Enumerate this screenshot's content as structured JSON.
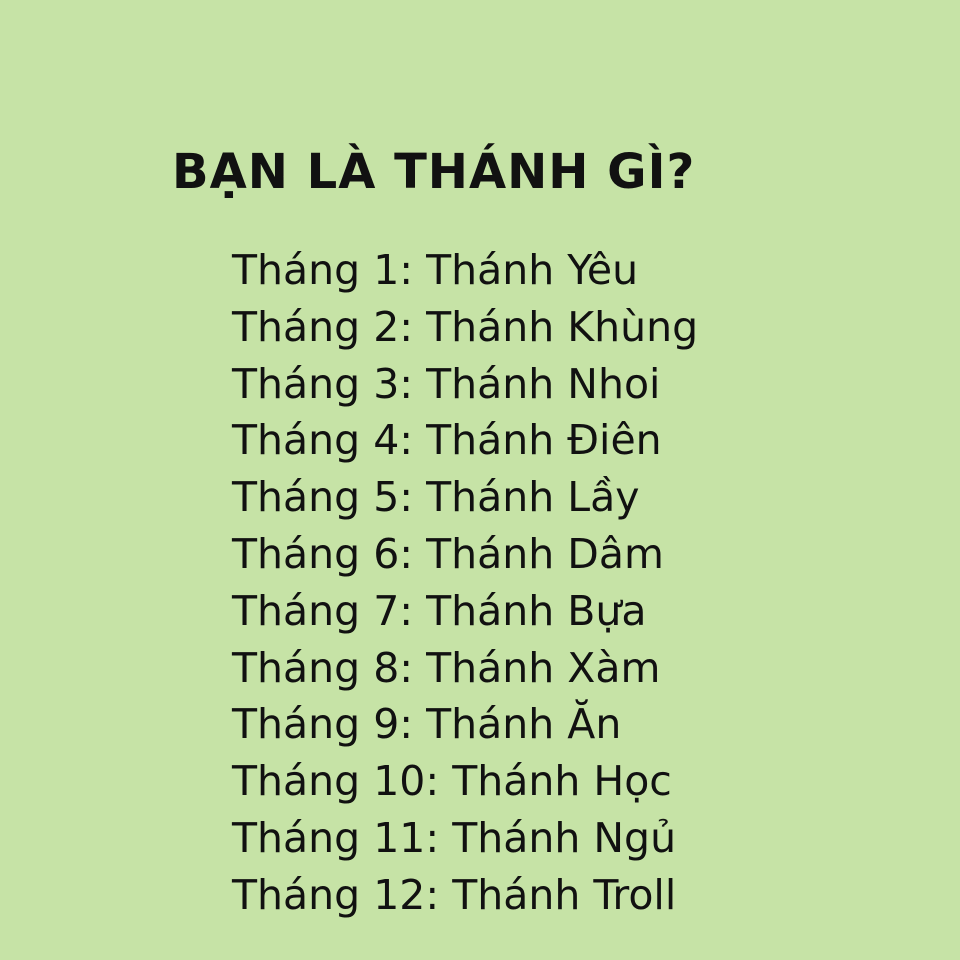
{
  "title": "BẠN LÀ THÁNH GÌ?",
  "months": [
    "Tháng 1: Thánh Yêu",
    "Tháng 2: Thánh Khùng",
    "Tháng 3: Thánh Nhoi",
    "Tháng 4: Thánh Điên",
    "Tháng 5: Thánh Lầy",
    "Tháng 6: Thánh Dâm",
    "Tháng 7: Thánh Bựa",
    "Tháng 8: Thánh Xàm",
    "Tháng 9: Thánh Ăn",
    "Tháng 10: Thánh Học",
    "Tháng 11: Thánh Ngủ",
    "Tháng 12: Thánh Troll"
  ],
  "colors": {
    "background": "#c6e3a6",
    "text": "#111111"
  }
}
